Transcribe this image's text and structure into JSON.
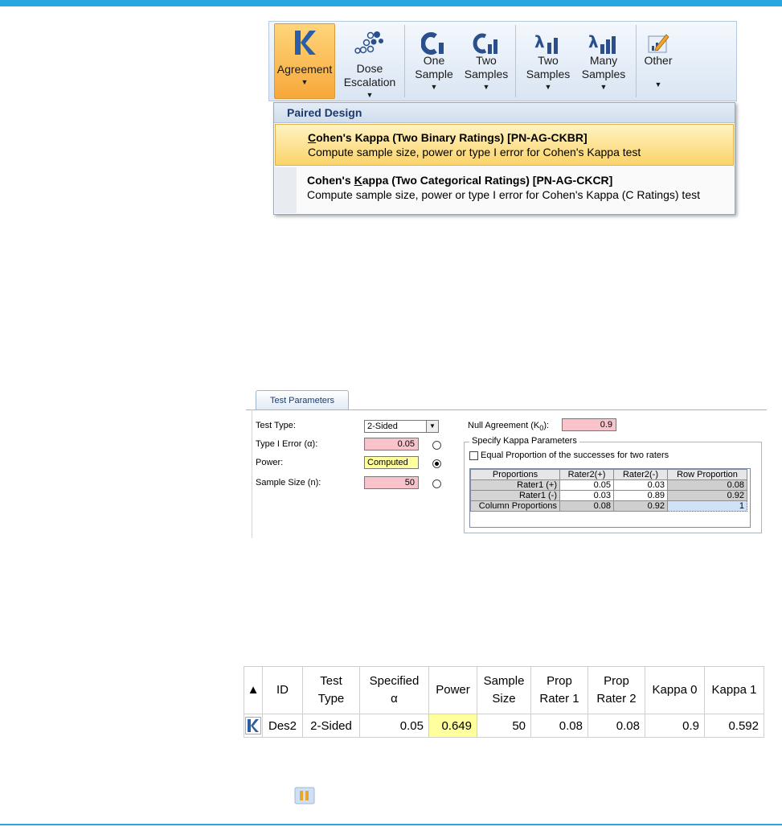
{
  "colors": {
    "accent_bar": "#29a8e0",
    "required_field": "#f9c3cc",
    "computed_field": "#ffff9e",
    "menu_highlight": "#fbd36a"
  },
  "ribbon": {
    "buttons": [
      {
        "label": "Agreement",
        "icon": "kappa-k-icon",
        "active": true
      },
      {
        "label": "Dose\nEscalation",
        "icon": "dose-circles-icon"
      },
      {
        "label": "One\nSample",
        "icon": "one-sample-c-icon"
      },
      {
        "label": "Two\nSamples",
        "icon": "two-samples-c-icon"
      },
      {
        "label": "Two\nSamples",
        "icon": "two-samples-lambda-icon"
      },
      {
        "label": "Many\nSamples",
        "icon": "many-samples-lambda-icon"
      },
      {
        "label": "Other",
        "icon": "pencil-chart-icon"
      }
    ],
    "arrow": "▼"
  },
  "menu": {
    "header": "Paired Design",
    "items": [
      {
        "title_mnemonic": "C",
        "title_rest": "ohen's Kappa (Two Binary Ratings) [PN-AG-CKBR]",
        "desc": "Compute sample size, power or type I error for Cohen's Kappa test"
      },
      {
        "title_pre": "Cohen's ",
        "title_mnemonic": "K",
        "title_rest": "appa (Two Categorical Ratings) [PN-AG-CKCR]",
        "desc": "Compute sample size, power or type I error for Cohen's Kappa (C Ratings) test"
      }
    ]
  },
  "test_parameters": {
    "tab": "Test Parameters",
    "test_type_label": "Test Type:",
    "test_type_value": "2-Sided",
    "type1_label": "Type I Error (α):",
    "type1_value": "0.05",
    "power_label": "Power:",
    "power_value": "Computed",
    "sample_label": "Sample Size (n):",
    "sample_value": "50",
    "null_label_pre": "Null Agreement (K",
    "null_label_sub": "0",
    "null_label_post": "):",
    "null_value": "0.9",
    "group_title": "Specify Kappa Parameters",
    "checkbox_label": "Equal Proportion of the successes for two raters",
    "table": {
      "headers": [
        "Proportions",
        "Rater2(+)",
        "Rater2(-)",
        "Row Proportion"
      ],
      "rows": [
        [
          "Rater1 (+)",
          "0.05",
          "0.03",
          "0.08"
        ],
        [
          "Rater1 (-)",
          "0.03",
          "0.89",
          "0.92"
        ],
        [
          "Column Proportions",
          "0.08",
          "0.92",
          "1"
        ]
      ]
    }
  },
  "results": {
    "sort_glyph": "▲",
    "headers": [
      "ID",
      "Test\nType",
      "Specified\nα",
      "Power",
      "Sample\nSize",
      "Prop\nRater 1",
      "Prop\nRater 2",
      "Kappa 0",
      "Kappa 1"
    ],
    "row": [
      "Des2",
      "2-Sided",
      "0.05",
      "0.649",
      "50",
      "0.08",
      "0.08",
      "0.9",
      "0.592"
    ]
  }
}
